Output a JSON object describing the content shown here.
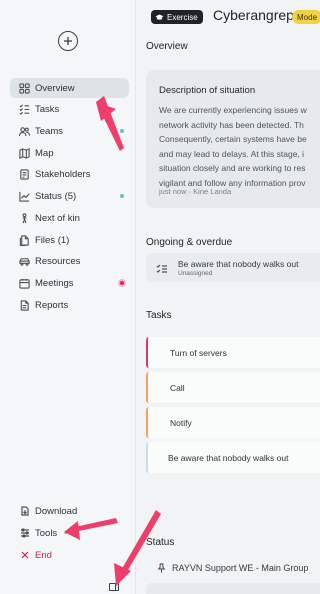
{
  "sidebar": {
    "nav": [
      {
        "label": "Overview",
        "icon": "grid-icon",
        "active": true
      },
      {
        "label": "Tasks",
        "icon": "list-check-icon"
      },
      {
        "label": "Teams",
        "icon": "users-icon",
        "dot": "teal"
      },
      {
        "label": "Map",
        "icon": "map-icon"
      },
      {
        "label": "Stakeholders",
        "icon": "stakeholders-icon"
      },
      {
        "label": "Status (5)",
        "icon": "chart-line-icon",
        "dot": "teal"
      },
      {
        "label": "Next of kin",
        "icon": "person-icon"
      },
      {
        "label": "Files (1)",
        "icon": "files-icon"
      },
      {
        "label": "Resources",
        "icon": "vehicle-icon"
      },
      {
        "label": "Meetings",
        "icon": "calendar-icon",
        "dot": "red"
      },
      {
        "label": "Reports",
        "icon": "document-icon"
      }
    ],
    "bottom": {
      "download": "Download",
      "tools": "Tools",
      "end": "End"
    }
  },
  "header": {
    "exercise_badge": "Exercise",
    "title": "Cyberangrep",
    "mode_badge": "Mode"
  },
  "overview": {
    "heading": "Overview",
    "description": {
      "title": "Description of situation",
      "lines": [
        "We are currently experiencing issues w",
        "network activity has been detected. Th",
        "Consequently, certain systems have be",
        "and may lead to delays. At this stage, i",
        "situation closely and are working to res",
        "vigilant and follow any information prov"
      ],
      "meta": "just now · Kine Landa"
    }
  },
  "ongoing": {
    "heading": "Ongoing & overdue",
    "item": {
      "text": "Be aware that nobody walks out",
      "sub": "Unassigned"
    }
  },
  "tasks": {
    "heading": "Tasks",
    "items": [
      {
        "label": "Turn of servers",
        "color": "#d63a6e"
      },
      {
        "label": "Call",
        "color": "#f0a35e"
      },
      {
        "label": "Notify",
        "color": "#f0a35e"
      },
      {
        "label": "Be aware that nobody walks out",
        "color": "#c9ddf0"
      }
    ]
  },
  "status": {
    "heading": "Status",
    "item": "RAYVN Support WE - Main Group"
  },
  "colors": {
    "accent_red": "#e2235e",
    "teal_dot": "#66c2c5",
    "arrow": "#ee3f6c",
    "mode_badge": "#f3d145"
  }
}
